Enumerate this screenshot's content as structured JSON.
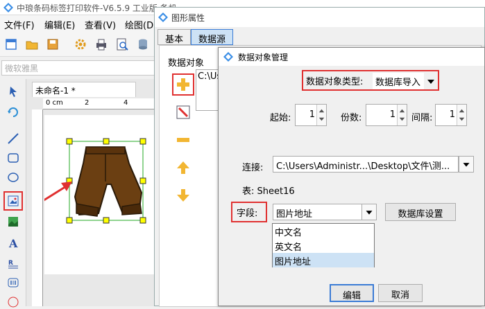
{
  "app": {
    "title": "中琅条码标签打印软件-V6.5.9 工业版 备机",
    "menus": [
      "文件(F)",
      "编辑(E)",
      "查看(V)",
      "绘图(D)"
    ],
    "font_placeholder": "微软雅黑",
    "document_tab": "未命名-1 *",
    "ruler_top_label": "0 cm",
    "ruler_marks": [
      "2",
      "4"
    ]
  },
  "props": {
    "title": "图形属性",
    "tabs": [
      "基本",
      "数据源"
    ],
    "group_label": "数据对象",
    "list_item": "C:\\Us"
  },
  "mgr": {
    "title": "数据对象管理",
    "type_label": "数据对象类型:",
    "type_value": "数据库导入",
    "start_label": "起始:",
    "start_value": "1",
    "copies_label": "份数:",
    "copies_value": "1",
    "interval_label": "间隔:",
    "interval_value": "1",
    "connect_label": "连接:",
    "connect_value": "C:\\Users\\Administr...\\Desktop\\文件\\测...",
    "table_label": "表: Sheet16",
    "field_label": "字段:",
    "field_value": "图片地址",
    "db_settings": "数据库设置",
    "options": [
      "中文名",
      "英文名",
      "图片地址"
    ],
    "selected_option": 2,
    "edit_button": "编辑",
    "cancel_button": "取消"
  },
  "colors": {
    "accent_red": "#e03030",
    "selected_bg": "#cde2f5",
    "pants_brown": "#6b3f12",
    "handle_yellow": "#ffff00"
  }
}
